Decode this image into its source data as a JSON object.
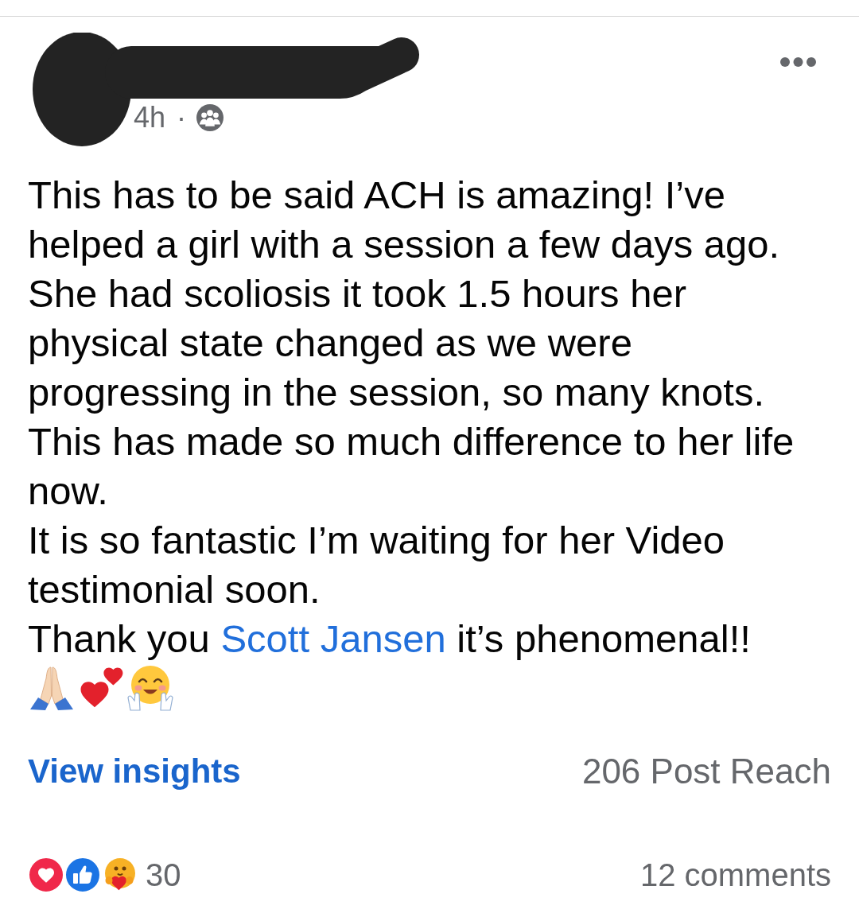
{
  "header": {
    "time": "4h",
    "separator": "·"
  },
  "post": {
    "paragraphs": [
      {
        "parts": [
          {
            "kind": "text",
            "text": "This has to be said ACH is amazing! I’ve helped a girl with a session a few days ago. She had scoliosis it took 1.5 hours her physical state changed as we were progressing in the session, so many knots. This has made so much difference to her life now."
          }
        ]
      },
      {
        "parts": [
          {
            "kind": "text",
            "text": "It is so fantastic I’m waiting for her Video testimonial soon."
          }
        ]
      },
      {
        "parts": [
          {
            "kind": "text",
            "text": "Thank you "
          },
          {
            "kind": "mention",
            "text": "Scott Jansen"
          },
          {
            "kind": "text",
            "text": " it’s phenomenal!!"
          }
        ]
      }
    ],
    "emojis": [
      {
        "kind": "praying_hands"
      },
      {
        "kind": "two_hearts"
      },
      {
        "kind": "hugging_face"
      }
    ]
  },
  "insights": {
    "link": "View insights",
    "reach": "206 Post Reach"
  },
  "footer": {
    "reactions": [
      {
        "kind": "love"
      },
      {
        "kind": "like"
      },
      {
        "kind": "care"
      }
    ],
    "reaction_count": "30",
    "comments": "12 comments"
  }
}
